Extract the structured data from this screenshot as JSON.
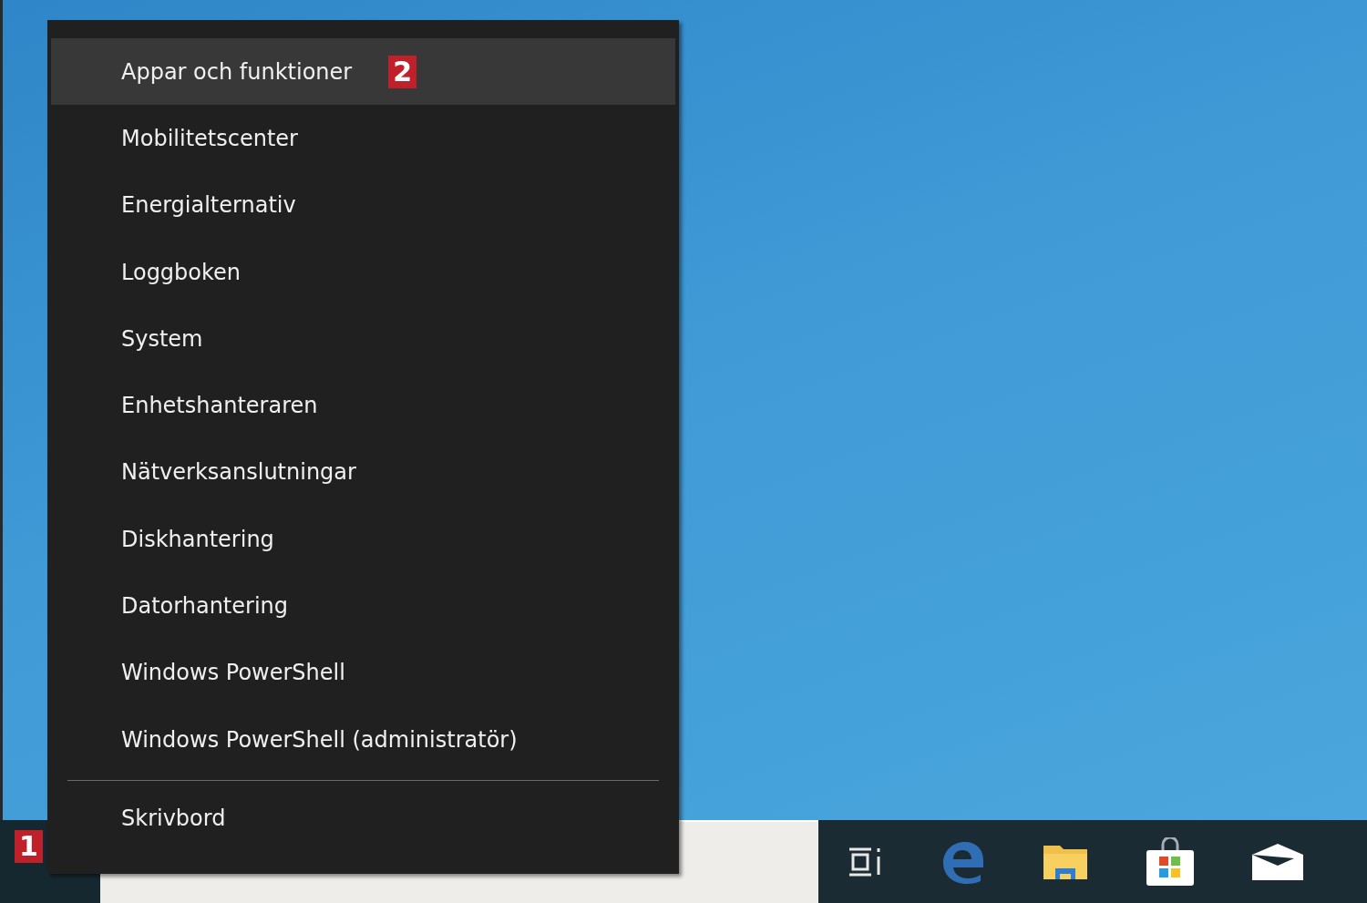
{
  "menu": {
    "items": [
      {
        "kind": "item",
        "label": "Appar och funktioner",
        "selected": true,
        "badge": "2"
      },
      {
        "kind": "item",
        "label": "Mobilitetscenter",
        "selected": false
      },
      {
        "kind": "item",
        "label": "Energialternativ",
        "selected": false
      },
      {
        "kind": "item",
        "label": "Loggboken",
        "selected": false
      },
      {
        "kind": "item",
        "label": "System",
        "selected": false
      },
      {
        "kind": "item",
        "label": "Enhetshanteraren",
        "selected": false
      },
      {
        "kind": "item",
        "label": "Nätverksanslutningar",
        "selected": false
      },
      {
        "kind": "item",
        "label": "Diskhantering",
        "selected": false
      },
      {
        "kind": "item",
        "label": "Datorhantering",
        "selected": false
      },
      {
        "kind": "item",
        "label": "Windows PowerShell",
        "selected": false
      },
      {
        "kind": "item",
        "label": "Windows PowerShell (administratör)",
        "selected": false
      },
      {
        "kind": "separator"
      },
      {
        "kind": "item",
        "label": "Skrivbord",
        "selected": false
      }
    ]
  },
  "taskbar": {
    "start_badge": "1",
    "icons": [
      {
        "kind": "taskview"
      },
      {
        "kind": "edge"
      },
      {
        "kind": "explorer"
      },
      {
        "kind": "store"
      },
      {
        "kind": "mail"
      }
    ]
  }
}
